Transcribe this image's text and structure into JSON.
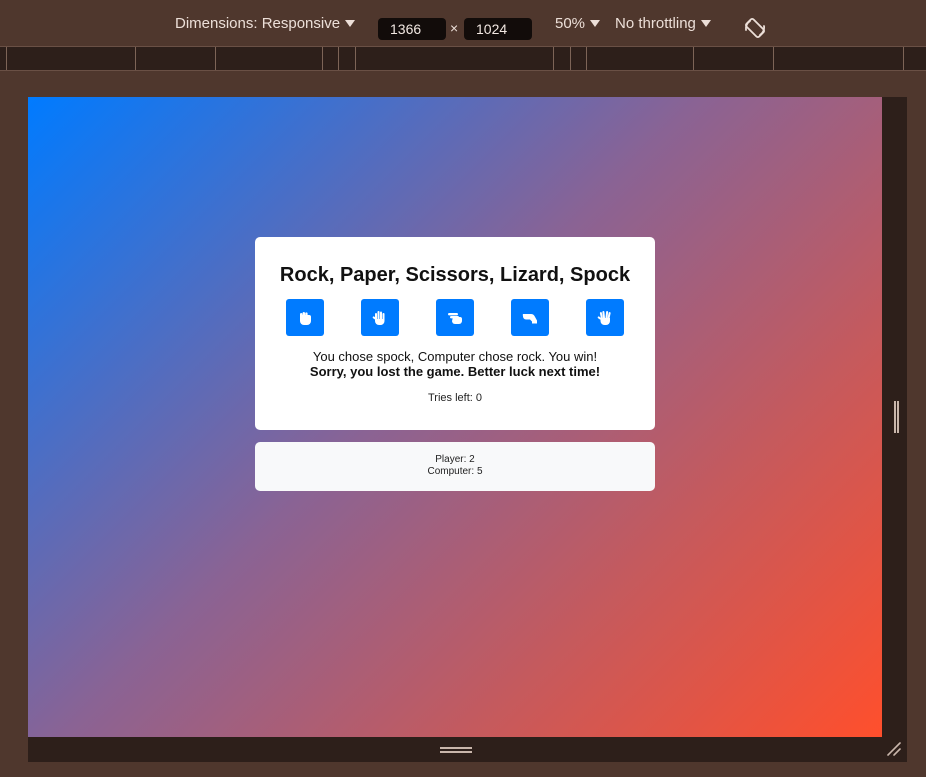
{
  "devtools": {
    "dimensions_label": "Dimensions: Responsive",
    "width_value": "1366",
    "times_symbol": "×",
    "height_value": "1024",
    "zoom_label": "50%",
    "throttle_label": "No throttling",
    "rotate_icon": "rotate-device-icon"
  },
  "game": {
    "title": "Rock, Paper, Scissors, Lizard, Spock",
    "choices": [
      {
        "label": "rock",
        "icon": "hand-rock-icon"
      },
      {
        "label": "paper",
        "icon": "hand-paper-icon"
      },
      {
        "label": "scissors",
        "icon": "hand-scissors-icon"
      },
      {
        "label": "lizard",
        "icon": "hand-lizard-icon"
      },
      {
        "label": "spock",
        "icon": "hand-spock-icon"
      }
    ],
    "result_text": "You chose spock, Computer chose rock. You win!",
    "final_message": "Sorry, you lost the game. Better luck next time!",
    "tries_text": "Tries left: 0",
    "accent_color": "#007bff"
  },
  "scoreboard": {
    "player_text": "Player: 2",
    "computer_text": "Computer: 5"
  }
}
